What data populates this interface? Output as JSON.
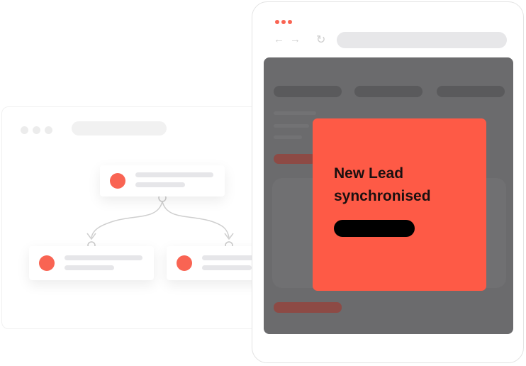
{
  "notification": {
    "title_line1": "New Lead",
    "title_line2": "synchronised"
  },
  "colors": {
    "accent": "#fe5a46",
    "node_accent": "#f96453",
    "overlay": "#6b6b6d",
    "placeholder": "#e6e6e9"
  },
  "icons": {
    "back": "arrow-left-icon",
    "forward": "arrow-right-icon",
    "reload": "reload-icon",
    "menu": "three-dots-icon"
  }
}
